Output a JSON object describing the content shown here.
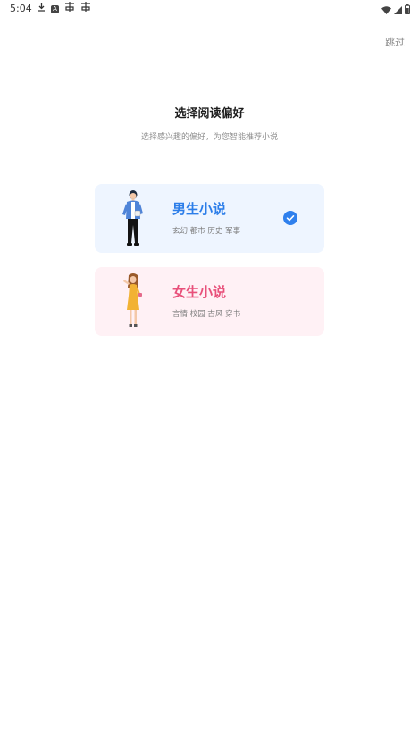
{
  "status_bar": {
    "time": "5:04",
    "icons": [
      "download-icon",
      "a-icon",
      "app-icon",
      "app-icon",
      "wifi-icon",
      "signal-icon",
      "battery-icon"
    ]
  },
  "header": {
    "skip_label": "跳过"
  },
  "main": {
    "title": "选择阅读偏好",
    "subtitle": "选择感兴趣的偏好，为您智能推荐小说",
    "options": [
      {
        "title": "男生小说",
        "tags": "玄幻 都市 历史 军事",
        "selected": true,
        "accent": "#2b7de9",
        "background": "#eef5ff"
      },
      {
        "title": "女生小说",
        "tags": "言情 校园 古风 穿书",
        "selected": false,
        "accent": "#e8507a",
        "background": "#fff1f5"
      }
    ]
  }
}
